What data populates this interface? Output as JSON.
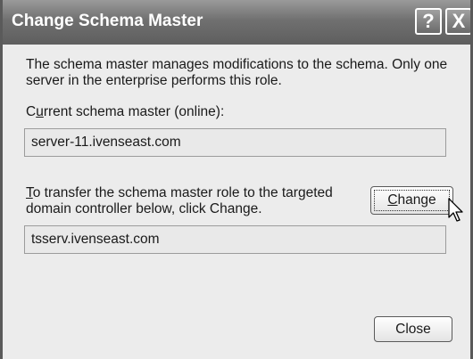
{
  "window": {
    "title": "Change Schema Master",
    "help_symbol": "?",
    "close_symbol": "X"
  },
  "description": {
    "line1": "The schema master manages modifications to the schema. Only one",
    "line2": "server in the enterprise performs this role."
  },
  "current": {
    "label_prefix": "C",
    "label_accel": "u",
    "label_rest": "rrent schema master (online):",
    "value": "server-11.ivenseast.com"
  },
  "transfer": {
    "line1_accel": "T",
    "line1_rest": "o transfer the schema master role to the targeted",
    "line2": "domain controller below, click Change.",
    "target_value": "tsserv.ivenseast.com"
  },
  "buttons": {
    "change_accel": "C",
    "change_rest": "hange",
    "close_label": "Close"
  },
  "icons": {
    "cursor": "arrow-cursor-icon"
  }
}
